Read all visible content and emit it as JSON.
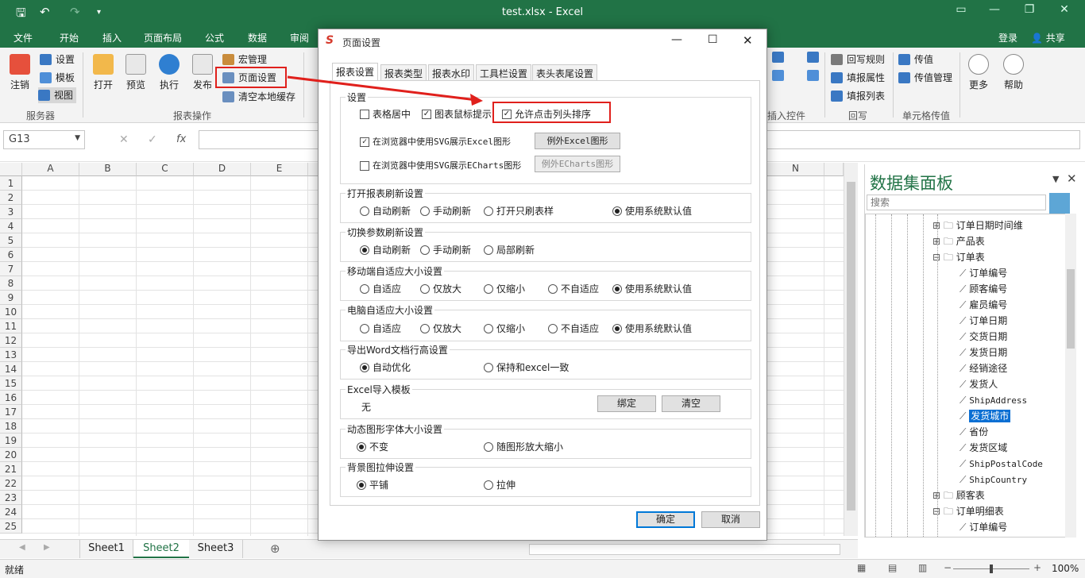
{
  "app": {
    "title": "test.xlsx - Excel",
    "tabs": [
      "文件",
      "开始",
      "插入",
      "页面布局",
      "公式",
      "数据",
      "审阅"
    ],
    "login": "登录",
    "share": "共享",
    "accent": "#217346"
  },
  "ribbon": {
    "logout": "注销",
    "settings": "设置",
    "template": "模板",
    "view": "视图",
    "server_group": "服务器",
    "open": "打开",
    "preview": "预览",
    "execute": "执行",
    "publish": "发布",
    "macro": "宏管理",
    "page_setup": "页面设置",
    "clear_cache": "清空本地缓存",
    "report_group": "报表操作",
    "insert_group": "插入控件",
    "write_rule": "回写规则",
    "fill_attr": "填报属性",
    "fill_list": "填报列表",
    "write_group": "回写",
    "pass_value": "传值",
    "pass_mgmt": "传值管理",
    "cell_group": "单元格传值",
    "more": "更多",
    "help": "帮助"
  },
  "formula": {
    "namebox": "G13"
  },
  "grid": {
    "columns": [
      "A",
      "B",
      "C",
      "D",
      "E",
      "N"
    ],
    "rows": [
      "1",
      "2",
      "3",
      "4",
      "5",
      "6",
      "7",
      "8",
      "9",
      "10",
      "11",
      "12",
      "13",
      "14",
      "15",
      "16",
      "17",
      "18",
      "19",
      "20",
      "21",
      "22",
      "23",
      "24",
      "25"
    ]
  },
  "sheets": {
    "tabs": [
      "Sheet1",
      "Sheet2",
      "Sheet3"
    ],
    "active": "Sheet2"
  },
  "status": {
    "ready": "就绪",
    "zoom": "100%"
  },
  "panel": {
    "title": "数据集面板",
    "search_placeholder": "搜索",
    "tree": [
      {
        "label": "订单日期时间维",
        "kind": "folder"
      },
      {
        "label": "产品表",
        "kind": "folder"
      },
      {
        "label": "订单表",
        "kind": "folder-open"
      },
      {
        "label": "订单编号",
        "kind": "field"
      },
      {
        "label": "顾客编号",
        "kind": "field"
      },
      {
        "label": "雇员编号",
        "kind": "field"
      },
      {
        "label": "订单日期",
        "kind": "field"
      },
      {
        "label": "交货日期",
        "kind": "field"
      },
      {
        "label": "发货日期",
        "kind": "field"
      },
      {
        "label": "经销途径",
        "kind": "field"
      },
      {
        "label": "发货人",
        "kind": "field"
      },
      {
        "label": "ShipAddress",
        "kind": "field"
      },
      {
        "label": "发货城市",
        "kind": "field",
        "selected": true
      },
      {
        "label": "省份",
        "kind": "field"
      },
      {
        "label": "发货区域",
        "kind": "field"
      },
      {
        "label": "ShipPostalCode",
        "kind": "field"
      },
      {
        "label": "ShipCountry",
        "kind": "field"
      },
      {
        "label": "顾客表",
        "kind": "folder"
      },
      {
        "label": "订单明细表",
        "kind": "folder-open"
      },
      {
        "label": "订单编号",
        "kind": "field"
      }
    ]
  },
  "dialog": {
    "title": "页面设置",
    "tabs": [
      "报表设置",
      "报表类型",
      "报表水印",
      "工具栏设置",
      "表头表尾设置"
    ],
    "settings_legend": "设置",
    "center_table": "表格居中",
    "chart_tip": "图表鼠标提示",
    "allow_sort": "允许点击列头排序",
    "svg_excel": "在浏览器中使用SVG展示Excel图形",
    "svg_echarts": "在浏览器中使用SVG展示ECharts图形",
    "except_excel": "例外Excel图形",
    "except_echarts": "例外ECharts图形",
    "open_refresh_legend": "打开报表刷新设置",
    "open_refresh_opts": [
      "自动刷新",
      "手动刷新",
      "打开只刷表样",
      "使用系统默认值"
    ],
    "switch_legend": "切换参数刷新设置",
    "switch_opts": [
      "自动刷新",
      "手动刷新",
      "局部刷新"
    ],
    "mobile_legend": "移动端自适应大小设置",
    "mobile_opts": [
      "自适应",
      "仅放大",
      "仅缩小",
      "不自适应",
      "使用系统默认值"
    ],
    "pc_legend": "电脑自适应大小设置",
    "pc_opts": [
      "自适应",
      "仅放大",
      "仅缩小",
      "不自适应",
      "使用系统默认值"
    ],
    "word_legend": "导出Word文档行高设置",
    "word_opts": [
      "自动优化",
      "保持和excel一致"
    ],
    "import_legend": "Excel导入模板",
    "import_value": "无",
    "bind": "绑定",
    "clear": "清空",
    "font_legend": "动态图形字体大小设置",
    "font_opts": [
      "不变",
      "随图形放大缩小"
    ],
    "bg_legend": "背景图拉伸设置",
    "bg_opts": [
      "平铺",
      "拉伸"
    ],
    "ok": "确定",
    "cancel": "取消"
  }
}
